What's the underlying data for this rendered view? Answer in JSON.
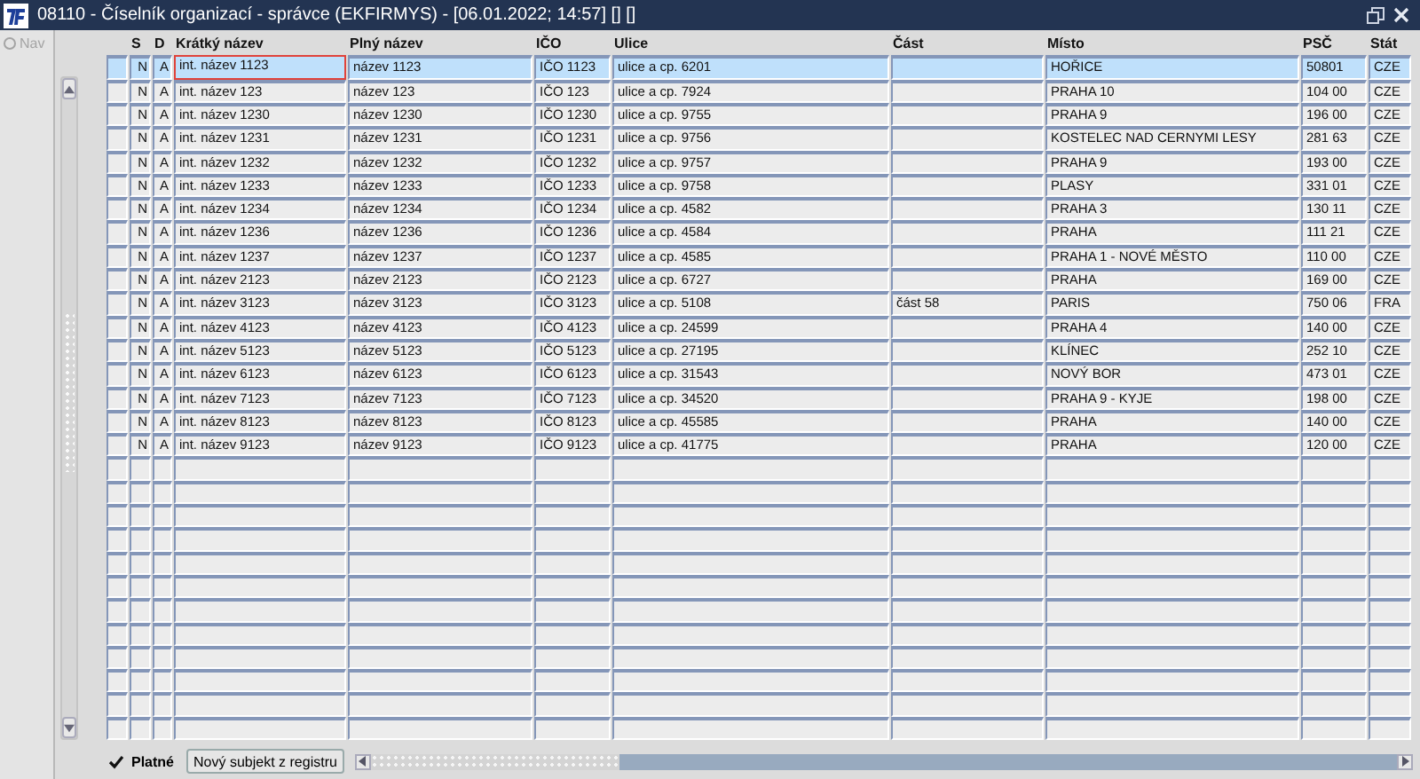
{
  "window": {
    "title": "08110 - Číselník organizací - správce (EKFIRMYS) - [06.01.2022; 14:57]  [] []"
  },
  "nav": {
    "label": "Nav",
    "disabled": true
  },
  "table": {
    "columns": [
      "S",
      "D",
      "Krátký název",
      "Plný název",
      "IČO",
      "Ulice",
      "Část",
      "Místo",
      "PSČ",
      "Stát"
    ],
    "rows": [
      {
        "selected": true,
        "cells": [
          "N",
          "A",
          "int. název 1123",
          "název 1123",
          "IČO 1123",
          "ulice a cp. 6201",
          "",
          "HOŘICE",
          "50801",
          "CZE"
        ]
      },
      {
        "selected": false,
        "cells": [
          "N",
          "A",
          "int. název 123",
          "název 123",
          "IČO 123",
          "ulice a cp. 7924",
          "",
          "PRAHA 10",
          "104 00",
          "CZE"
        ]
      },
      {
        "selected": false,
        "cells": [
          "N",
          "A",
          "int. název 1230",
          "název 1230",
          "IČO 1230",
          "ulice a cp. 9755",
          "",
          "PRAHA 9",
          "196 00",
          "CZE"
        ]
      },
      {
        "selected": false,
        "cells": [
          "N",
          "A",
          "int. název 1231",
          "název 1231",
          "IČO 1231",
          "ulice a cp. 9756",
          "",
          "KOSTELEC NAD CERNYMI LESY",
          "281 63",
          "CZE"
        ]
      },
      {
        "selected": false,
        "cells": [
          "N",
          "A",
          "int. název 1232",
          "název 1232",
          "IČO 1232",
          "ulice a cp. 9757",
          "",
          "PRAHA 9",
          "193 00",
          "CZE"
        ]
      },
      {
        "selected": false,
        "cells": [
          "N",
          "A",
          "int. název 1233",
          "název 1233",
          "IČO 1233",
          "ulice a cp. 9758",
          "",
          "PLASY",
          "331 01",
          "CZE"
        ]
      },
      {
        "selected": false,
        "cells": [
          "N",
          "A",
          "int. název 1234",
          "název 1234",
          "IČO 1234",
          "ulice a cp. 4582",
          "",
          "PRAHA 3",
          "130 11",
          "CZE"
        ]
      },
      {
        "selected": false,
        "cells": [
          "N",
          "A",
          "int. název 1236",
          "název 1236",
          "IČO 1236",
          "ulice a cp. 4584",
          "",
          "PRAHA",
          "111 21",
          "CZE"
        ]
      },
      {
        "selected": false,
        "cells": [
          "N",
          "A",
          "int. název 1237",
          "název 1237",
          "IČO 1237",
          "ulice a cp. 4585",
          "",
          "PRAHA 1 - NOVÉ MĚSTO",
          "110 00",
          "CZE"
        ]
      },
      {
        "selected": false,
        "cells": [
          "N",
          "A",
          "int. název 2123",
          "název 2123",
          "IČO 2123",
          "ulice a cp. 6727",
          "",
          "PRAHA",
          "169 00",
          "CZE"
        ]
      },
      {
        "selected": false,
        "cells": [
          "N",
          "A",
          "int. název 3123",
          "název 3123",
          "IČO 3123",
          "ulice a cp. 5108",
          "část 58",
          "PARIS",
          "750 06",
          "FRA"
        ]
      },
      {
        "selected": false,
        "cells": [
          "N",
          "A",
          "int. název 4123",
          "název 4123",
          "IČO 4123",
          "ulice a cp. 24599",
          "",
          "PRAHA 4",
          "140 00",
          "CZE"
        ]
      },
      {
        "selected": false,
        "cells": [
          "N",
          "A",
          "int. název 5123",
          "název 5123",
          "IČO 5123",
          "ulice a cp. 27195",
          "",
          "KLÍNEC",
          "252 10",
          "CZE"
        ]
      },
      {
        "selected": false,
        "cells": [
          "N",
          "A",
          "int. název 6123",
          "název 6123",
          "IČO 6123",
          "ulice a cp. 31543",
          "",
          "NOVÝ BOR",
          "473 01",
          "CZE"
        ]
      },
      {
        "selected": false,
        "cells": [
          "N",
          "A",
          "int. název 7123",
          "název 7123",
          "IČO 7123",
          "ulice a cp. 34520",
          "",
          "PRAHA 9 - KYJE",
          "198 00",
          "CZE"
        ]
      },
      {
        "selected": false,
        "cells": [
          "N",
          "A",
          "int. název 8123",
          "název 8123",
          "IČO 8123",
          "ulice a cp. 45585",
          "",
          "PRAHA",
          "140 00",
          "CZE"
        ]
      },
      {
        "selected": false,
        "cells": [
          "N",
          "A",
          "int. název 9123",
          "název 9123",
          "IČO 9123",
          "ulice a cp. 41775",
          "",
          "PRAHA",
          "120 00",
          "CZE"
        ]
      }
    ]
  },
  "footer": {
    "checkbox": {
      "label": "Platné",
      "checked": true
    },
    "button": "Nový subjekt z registru"
  }
}
